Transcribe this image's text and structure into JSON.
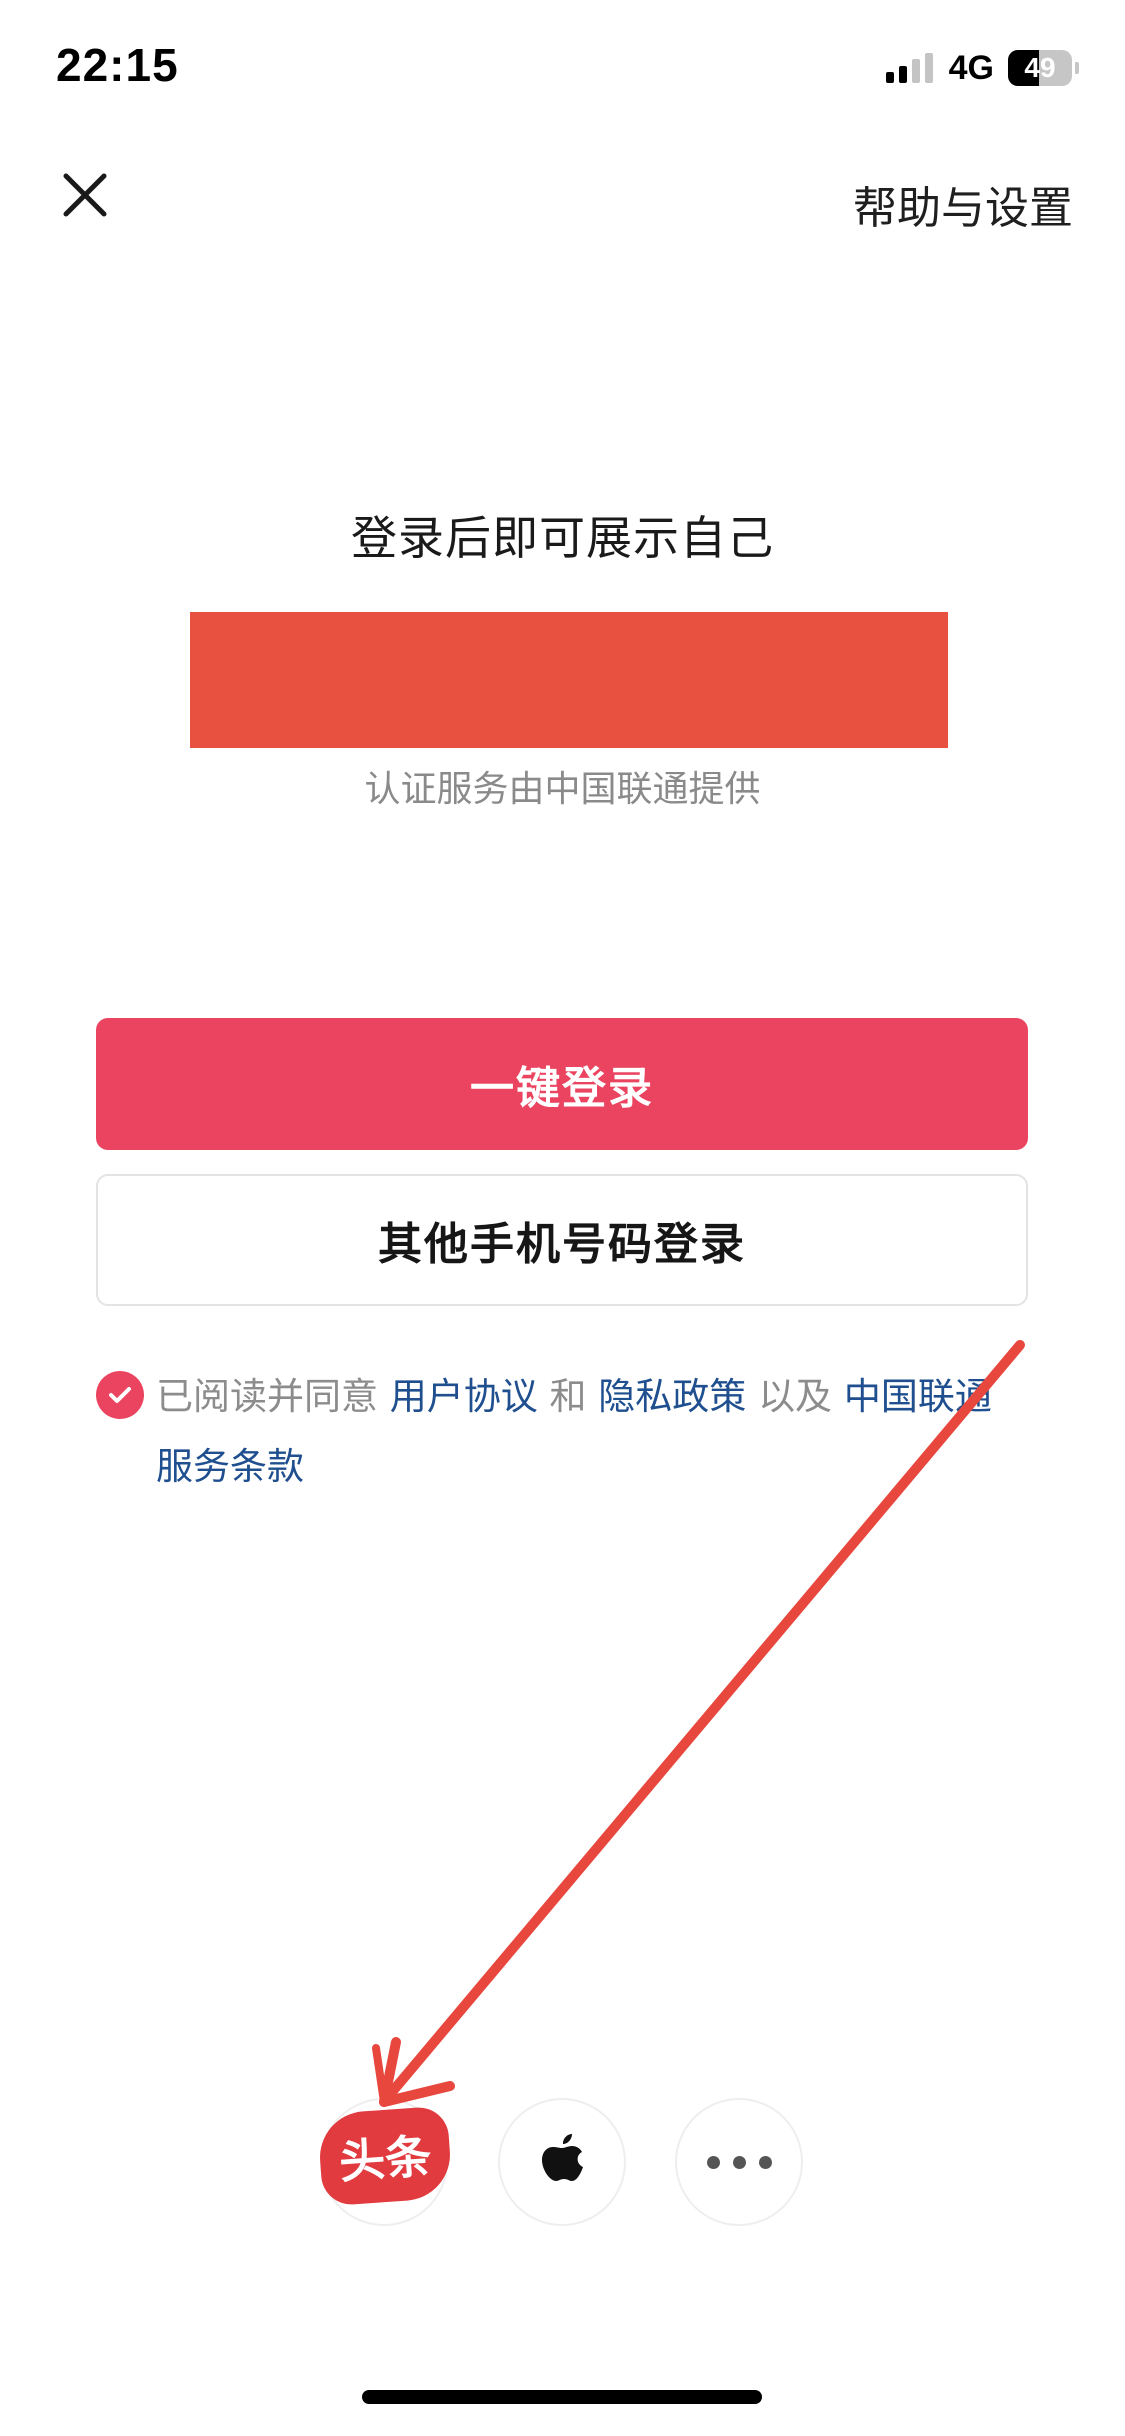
{
  "status_bar": {
    "time": "22:15",
    "network": "4G",
    "battery": "49",
    "battery_level": 0.49,
    "signal_bars_active": 2,
    "signal_bars_total": 4
  },
  "header": {
    "close_icon": "close-icon",
    "help_label": "帮助与设置"
  },
  "login": {
    "prompt": "登录后即可展示自己",
    "provider_note": "认证服务由中国联通提供",
    "one_click_label": "一键登录",
    "other_phone_label": "其他手机号码登录",
    "primary_color": "#ea4460",
    "mask_color": "#e8503f"
  },
  "agreement": {
    "checked": true,
    "prefix": "已阅读并同意",
    "user_agreement": "用户协议",
    "and": "和",
    "privacy_policy": "隐私政策",
    "also": "以及",
    "carrier_terms": "中国联通服务条款",
    "link_color": "#1f4f8f"
  },
  "third_party": {
    "toutiao_label": "头条",
    "apple_icon": "apple-icon",
    "more_icon": "more-icon",
    "toutiao_color": "#e13a3f"
  },
  "annotation": {
    "arrow_color": "#e8473d"
  }
}
